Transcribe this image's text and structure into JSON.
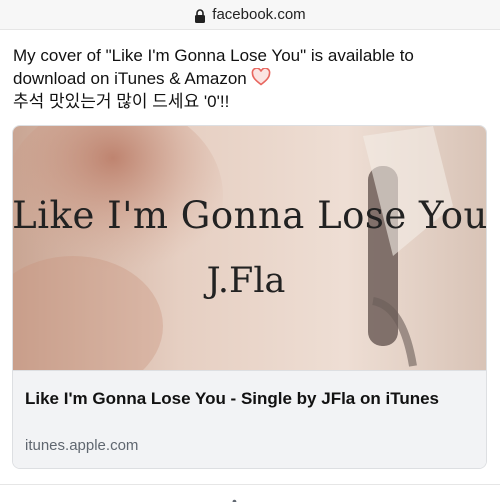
{
  "browser": {
    "url": "facebook.com",
    "lock_icon": "lock-icon"
  },
  "post": {
    "line1": "My cover of \"Like I'm Gonna Lose You\" is available to",
    "line2": "download on iTunes & Amazon",
    "line3": "추석 맛있는거 많이 드세요 '0'!!",
    "heart_icon": "heart-outline-icon",
    "heart_color": "#e8665f"
  },
  "link_preview": {
    "image_title": "Like I'm Gonna Lose You",
    "image_artist": "J.Fla",
    "title": "Like I'm Gonna Lose You - Single by JFla on iTunes",
    "domain": "itunes.apple.com"
  },
  "colors": {
    "image_tone": "#d9b8a6",
    "footer_bg": "#f2f3f5",
    "border": "#dddfe2"
  }
}
